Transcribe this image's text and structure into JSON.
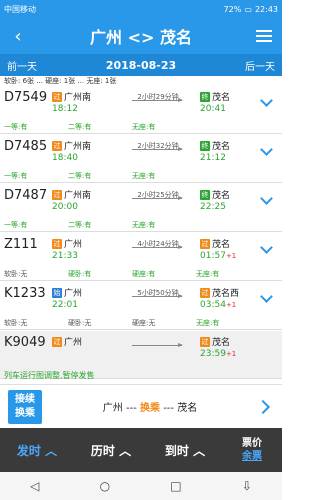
{
  "status": {
    "carrier": "中国移动",
    "battery": "72%",
    "time": "22:43"
  },
  "header": {
    "title": "广州 <> 茂名"
  },
  "datebar": {
    "prev_label": "前一天",
    "date": "2018-08-23",
    "next_label": "后一天"
  },
  "top_seats": {
    "text": "软卧: 6张 ... 硬座: 1张 ... 无座: 1张"
  },
  "trains": [
    {
      "no": "D7549",
      "dep": "广州南",
      "dep_badge": "过",
      "dep_time": "18:12",
      "duration": "2小时29分钟",
      "arr": "茂名",
      "arr_badge": "终",
      "arr_time": "20:41",
      "plus": "",
      "seats": [
        "一等:有",
        "二等:有",
        "无座:有"
      ],
      "gray": false
    },
    {
      "no": "D7485",
      "dep": "广州南",
      "dep_badge": "过",
      "dep_time": "18:40",
      "duration": "2小时32分钟",
      "arr": "茂名",
      "arr_badge": "终",
      "arr_time": "21:12",
      "plus": "",
      "seats": [
        "一等:有",
        "二等:有",
        "无座:有"
      ],
      "gray": false
    },
    {
      "no": "D7487",
      "dep": "广州南",
      "dep_badge": "过",
      "dep_time": "20:00",
      "duration": "2小时25分钟",
      "arr": "茂名",
      "arr_badge": "终",
      "arr_time": "22:25",
      "plus": "",
      "seats": [
        "一等:有",
        "二等:有",
        "无座:有"
      ],
      "gray": false
    },
    {
      "no": "Z111",
      "dep": "广州",
      "dep_badge": "过",
      "dep_time": "21:33",
      "duration": "4小时24分钟",
      "arr": "茂名",
      "arr_badge": "过",
      "arr_time": "01:57",
      "plus": "+1",
      "seats": [
        "软卧:无",
        "硬卧:有",
        "硬座:有",
        "无座:有"
      ],
      "gray": false
    },
    {
      "no": "K1233",
      "dep": "广州",
      "dep_badge": "始",
      "dep_time": "22:01",
      "duration": "5小时50分钟",
      "arr": "茂名西",
      "arr_badge": "过",
      "arr_time": "03:54",
      "plus": "+1",
      "seats": [
        "软卧:无",
        "硬卧:无",
        "硬座:无",
        "无座:有"
      ],
      "gray": false
    },
    {
      "no": "K9049",
      "dep": "广州",
      "dep_badge": "过",
      "dep_time": "",
      "duration": "",
      "arr": "茂名",
      "arr_badge": "过",
      "arr_time": "23:59",
      "plus": "+1",
      "seats": [],
      "gray": true
    }
  ],
  "notice": "列车运行图调整,暂停发售",
  "transfer": {
    "button_line1": "接续",
    "button_line2": "换乘",
    "from": "广州",
    "mid": "换乘",
    "to": "茂名"
  },
  "sortbar": {
    "dep_label": "发时",
    "dur_label": "历时",
    "arr_label": "到时",
    "price_line1": "票价",
    "price_line2": "余票"
  },
  "colors": {
    "primary": "#2a98e8",
    "accent_green": "#2aa530",
    "accent_orange": "#f08a1a"
  }
}
